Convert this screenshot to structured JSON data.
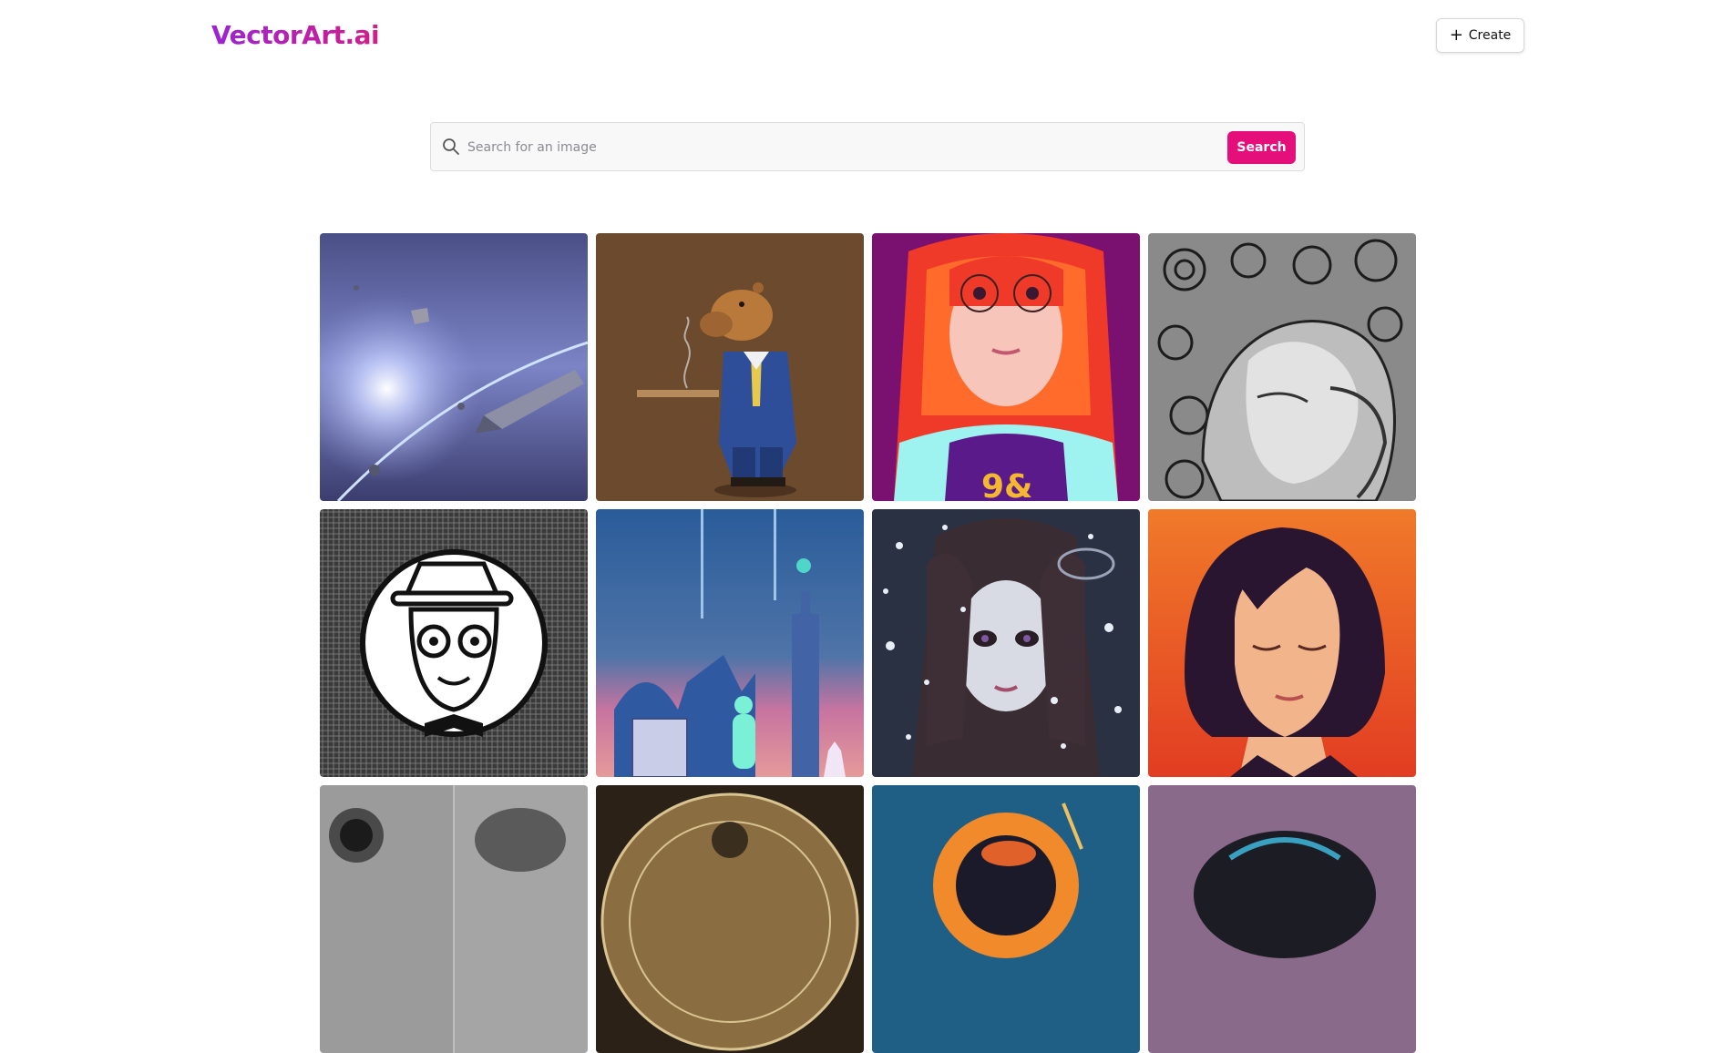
{
  "header": {
    "logo": "VectorArt.ai",
    "create_label": "Create"
  },
  "search": {
    "placeholder": "Search for an image",
    "button_label": "Search"
  },
  "colors": {
    "accent": "#e40f7a",
    "logo_start": "#9b24d6",
    "logo_end": "#d11f86"
  },
  "gallery": {
    "images": [
      {
        "name": "space-spaceship-image"
      },
      {
        "name": "capybara-businessman-image"
      },
      {
        "name": "red-hair-girl-glasses-image"
      },
      {
        "name": "mechanical-woman-bw-image"
      },
      {
        "name": "man-hat-glasses-icon-image"
      },
      {
        "name": "city-skyline-planet-image"
      },
      {
        "name": "snow-girl-portrait-image"
      },
      {
        "name": "woman-eyes-closed-portrait-image"
      },
      {
        "name": "astronaut-bw-image"
      },
      {
        "name": "astrolabe-sepia-image"
      },
      {
        "name": "orange-planet-image"
      },
      {
        "name": "purple-sphere-image"
      }
    ]
  }
}
